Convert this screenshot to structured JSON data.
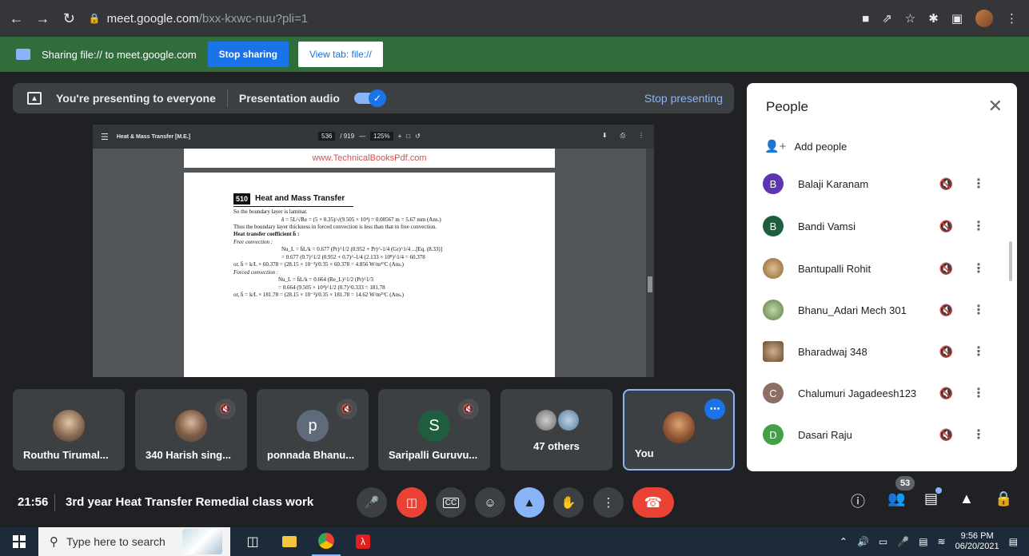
{
  "browser": {
    "url_host": "meet.google.com",
    "url_path": "/bxx-kxwc-nuu?pli=1"
  },
  "sharing_bar": {
    "text": "Sharing file:// to meet.google.com",
    "stop_label": "Stop sharing",
    "view_tab_label": "View tab: file://"
  },
  "presenting_bar": {
    "text": "You're presenting to everyone",
    "audio_label": "Presentation audio",
    "stop_label": "Stop presenting"
  },
  "pdf": {
    "title": "Heat & Mass Transfer [M.E.]",
    "page_current": "536",
    "page_total": "/ 919",
    "zoom": "125%",
    "watermark": "www.TechnicalBooksPdf.com",
    "chapter_number": "510",
    "chapter_title": "Heat and Mass Transfer",
    "lines": {
      "l1": "So the boundary layer is laminar.",
      "l2": "δ = 5L/√Re = (5 × 0.35)/√(9.505 × 10⁴) = 0.00567 m = 5.67 mm   (Ans.)",
      "l3": "Thus the boundary layer thickness in forced convection is less than that in free convection.",
      "l4": "Heat transfer coefficient h̄ :",
      "l5": "Free convection :",
      "l6": "Nu_L = h̄L/k = 0.677 (Pr)^1/2 (0.952 + Pr)^-1/4 (Gr)^1/4   ...[Eq. (8.33)]",
      "l7": "= 0.677 (0.7)^1/2 (0.952 + 0.7)^-1/4 (2.133 × 10⁸)^1/4 = 60.378",
      "l8": "or,   h̄ = k/L × 60.378 = (28.15 × 10⁻³)/0.35 × 60.378 = 4.856 W/m²°C   (Ans.)",
      "l9": "Forced convection :",
      "l10": "Nu_L = h̄L/k = 0.664 (Re_L)^1/2 (Pr)^1/3",
      "l11": "= 0.664 (9.505 × 10⁴)^1/2 (0.7)^0.333 = 181.78",
      "l12": "or,   h̄ = k/L × 181.78 = (28.15 × 10⁻³)/0.35 × 181.78 = 14.62 W/m²°C   (Ans.)"
    }
  },
  "tiles": {
    "t1": "Routhu Tirumal...",
    "t2": "340 Harish sing...",
    "t3_initial": "p",
    "t3": "ponnada Bhanu...",
    "t4_initial": "S",
    "t4": "Saripalli Guruvu...",
    "others": "47 others",
    "you": "You"
  },
  "people_panel": {
    "title": "People",
    "add_people": "Add people",
    "participants": [
      {
        "initial": "B",
        "name": "Balaji Karanam",
        "color": "#5e35b1"
      },
      {
        "initial": "B",
        "name": "Bandi Vamsi",
        "color": "#1e5e3e"
      },
      {
        "initial": "",
        "name": "Bantupalli Rohit",
        "color": "#c9a06a"
      },
      {
        "initial": "",
        "name": "Bhanu_Adari Mech 301",
        "color": "#7a9a6a"
      },
      {
        "initial": "",
        "name": "Bharadwaj 348",
        "color": "#8a6a4a"
      },
      {
        "initial": "C",
        "name": "Chalumuri Jagadeesh123",
        "color": "#8d6e63"
      },
      {
        "initial": "D",
        "name": "Dasari Raju",
        "color": "#43a047"
      }
    ]
  },
  "meeting": {
    "time": "21:56",
    "title": "3rd year Heat Transfer Remedial class work",
    "people_count": "53"
  },
  "taskbar": {
    "search_placeholder": "Type here to search",
    "clock_time": "9:56 PM",
    "clock_date": "06/20/2021"
  }
}
